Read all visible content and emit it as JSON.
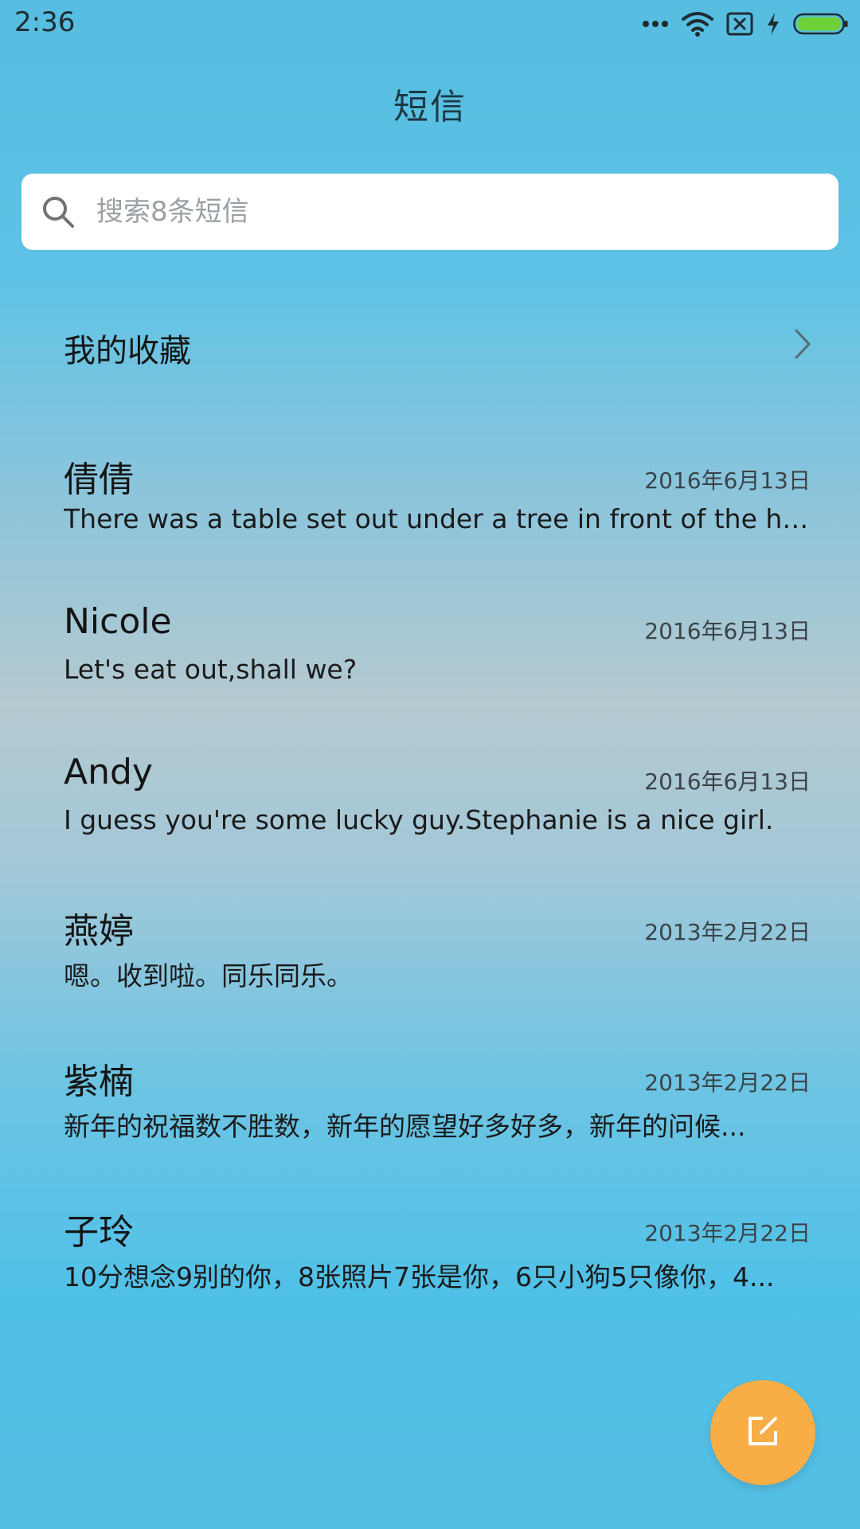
{
  "status_bar": {
    "time": "2:36",
    "icons": [
      "more-dots-icon",
      "wifi-icon",
      "sim-error-icon",
      "charging-bolt-icon",
      "battery-icon"
    ],
    "battery_color": "#6fd13a"
  },
  "header": {
    "title": "短信"
  },
  "search": {
    "placeholder": "搜索8条短信",
    "value": ""
  },
  "favorites": {
    "label": "我的收藏"
  },
  "conversations": [
    {
      "name": "倩倩",
      "date": "2016年6月13日",
      "preview": "There was a table set out under a tree in front of the ho..."
    },
    {
      "name": "Nicole",
      "date": "2016年6月13日",
      "preview": "Let's eat out,shall we?"
    },
    {
      "name": "Andy",
      "date": "2016年6月13日",
      "preview": "I guess you're some lucky guy.Stephanie is a nice girl."
    },
    {
      "name": "燕婷",
      "date": "2013年2月22日",
      "preview": "嗯。收到啦。同乐同乐。"
    },
    {
      "name": "紫楠",
      "date": "2013年2月22日",
      "preview": "新年的祝福数不胜数，新年的愿望好多好多，新年的问候..."
    },
    {
      "name": "子玲",
      "date": "2013年2月22日",
      "preview": "10分想念9别的你，8张照片7张是你，6只小狗5只像你，4..."
    }
  ],
  "fab": {
    "icon": "compose-icon",
    "color": "#f8ad45"
  }
}
